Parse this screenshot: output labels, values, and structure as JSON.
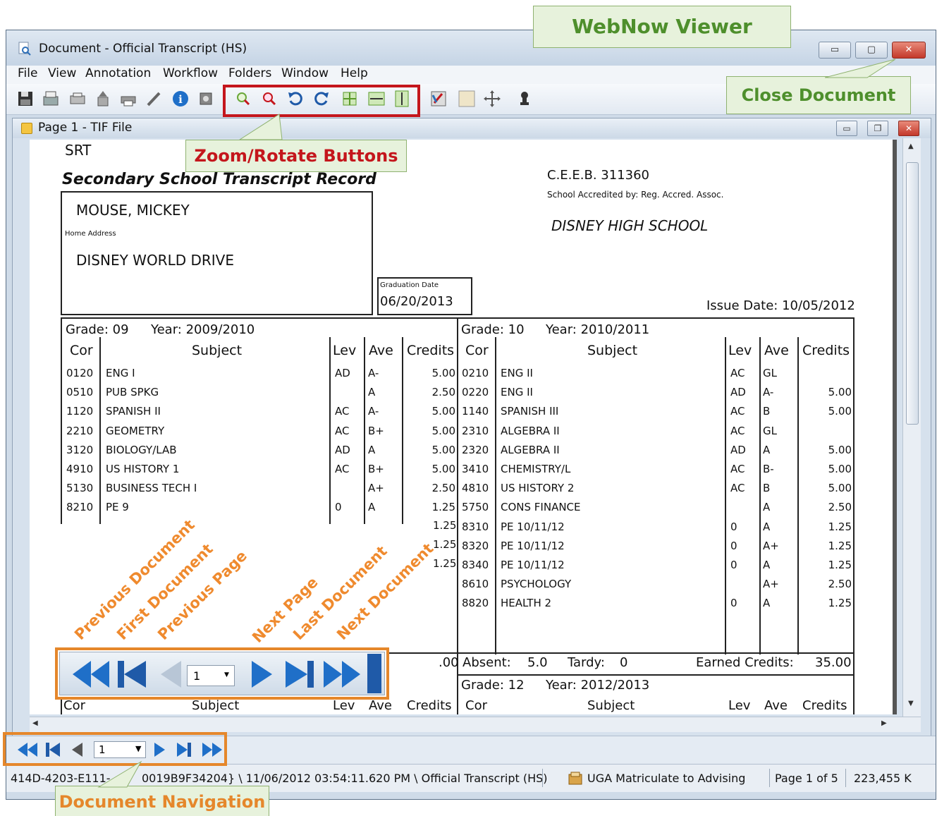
{
  "window": {
    "title": "Document - Official Transcript (HS)",
    "menu": [
      "File",
      "View",
      "Annotation",
      "Workflow",
      "Folders",
      "Window",
      "Help"
    ]
  },
  "doc_window": {
    "title": "Page 1 - TIF File"
  },
  "transcript": {
    "srt": "SRT",
    "heading": "Secondary School Transcript Record",
    "ceeb": "C.E.E.B. 311360",
    "accredited": "School Accredited by: Reg. Accred. Assoc.",
    "school": "DISNEY HIGH SCHOOL",
    "name": "MOUSE, MICKEY",
    "home_address_label": "Home Address",
    "address": "DISNEY WORLD DRIVE",
    "graduation_label": "Graduation Date",
    "graduation_date": "06/20/2013",
    "issue_date": "Issue Date: 10/05/2012",
    "left_grade": "Grade:  09",
    "left_year": "Year: 2009/2010",
    "right_grade": "Grade:  10",
    "right_year": "Year: 2010/2011",
    "headers": {
      "cor": "Cor",
      "subject": "Subject",
      "lev": "Lev",
      "ave": "Ave",
      "credits": "Credits"
    },
    "left_rows": [
      {
        "cor": "0120",
        "subject": "ENG I",
        "lev": "AD",
        "ave": "A-",
        "credits": "5.00"
      },
      {
        "cor": "0510",
        "subject": "PUB SPKG",
        "lev": "",
        "ave": "A",
        "credits": "2.50"
      },
      {
        "cor": "1120",
        "subject": "SPANISH II",
        "lev": "AC",
        "ave": "A-",
        "credits": "5.00"
      },
      {
        "cor": "2210",
        "subject": "GEOMETRY",
        "lev": "AC",
        "ave": "B+",
        "credits": "5.00"
      },
      {
        "cor": "3120",
        "subject": "BIOLOGY/LAB",
        "lev": "AD",
        "ave": "A",
        "credits": "5.00"
      },
      {
        "cor": "4910",
        "subject": "US HISTORY 1",
        "lev": "AC",
        "ave": "B+",
        "credits": "5.00"
      },
      {
        "cor": "5130",
        "subject": "BUSINESS TECH I",
        "lev": "",
        "ave": "A+",
        "credits": "2.50"
      },
      {
        "cor": "8210",
        "subject": "PE 9",
        "lev": "0",
        "ave": "A",
        "credits": "1.25"
      }
    ],
    "left_partial_credits": [
      "1.25",
      "1.25",
      "1.25"
    ],
    "left_partial_total": ".00",
    "right_rows": [
      {
        "cor": "0210",
        "subject": "ENG II",
        "lev": "AC",
        "ave": "GL",
        "credits": ""
      },
      {
        "cor": "0220",
        "subject": "ENG II",
        "lev": "AD",
        "ave": "A-",
        "credits": "5.00"
      },
      {
        "cor": "1140",
        "subject": "SPANISH III",
        "lev": "AC",
        "ave": "B",
        "credits": "5.00"
      },
      {
        "cor": "2310",
        "subject": "ALGEBRA II",
        "lev": "AC",
        "ave": "GL",
        "credits": ""
      },
      {
        "cor": "2320",
        "subject": "ALGEBRA II",
        "lev": "AD",
        "ave": "A",
        "credits": "5.00"
      },
      {
        "cor": "3410",
        "subject": "CHEMISTRY/L",
        "lev": "AC",
        "ave": "B-",
        "credits": "5.00"
      },
      {
        "cor": "4810",
        "subject": "US HISTORY 2",
        "lev": "AC",
        "ave": "B",
        "credits": "5.00"
      },
      {
        "cor": "5750",
        "subject": "CONS FINANCE",
        "lev": "",
        "ave": "A",
        "credits": "2.50"
      },
      {
        "cor": "8310",
        "subject": "PE 10/11/12",
        "lev": "0",
        "ave": "A",
        "credits": "1.25"
      },
      {
        "cor": "8320",
        "subject": "PE 10/11/12",
        "lev": "0",
        "ave": "A+",
        "credits": "1.25"
      },
      {
        "cor": "8340",
        "subject": "PE 10/11/12",
        "lev": "0",
        "ave": "A",
        "credits": "1.25"
      },
      {
        "cor": "8610",
        "subject": "PSYCHOLOGY",
        "lev": "",
        "ave": "A+",
        "credits": "2.50"
      },
      {
        "cor": "8820",
        "subject": "HEALTH 2",
        "lev": "0",
        "ave": "A",
        "credits": "1.25"
      }
    ],
    "absent_label": "Absent:",
    "absent_value": "5.0",
    "tardy_label": "Tardy:",
    "tardy_value": "0",
    "earned_label": "Earned Credits:",
    "earned_value": "35.00",
    "grade12": "Grade:  12",
    "year12": "Year: 2012/2013"
  },
  "nav": {
    "page_value": "1",
    "inset_page_value": "1"
  },
  "status": {
    "path_left": "414D-4203-E111-",
    "path_right": "0019B9F34204} \\ 11/06/2012 03:54:11.620 PM \\ Official Transcript (HS)",
    "queue": "UGA Matriculate to Advising",
    "page_of": "Page 1 of 5",
    "size": "223,455 K"
  },
  "annotations": {
    "webnow_viewer": "WebNow Viewer",
    "close_document": "Close Document",
    "zoom_rotate": "Zoom/Rotate Buttons",
    "document_navigation": "Document Navigation",
    "previous_document": "Previous Document",
    "first_document": "First Document",
    "previous_page": "Previous Page",
    "next_page": "Next Page",
    "last_document": "Last Document",
    "next_document": "Next Document"
  },
  "colors": {
    "callout_green_text": "#4e8f2c",
    "callout_red_text": "#c4161c",
    "callout_orange_text": "#e5872b",
    "nav_blue": "#1f6fc8"
  }
}
